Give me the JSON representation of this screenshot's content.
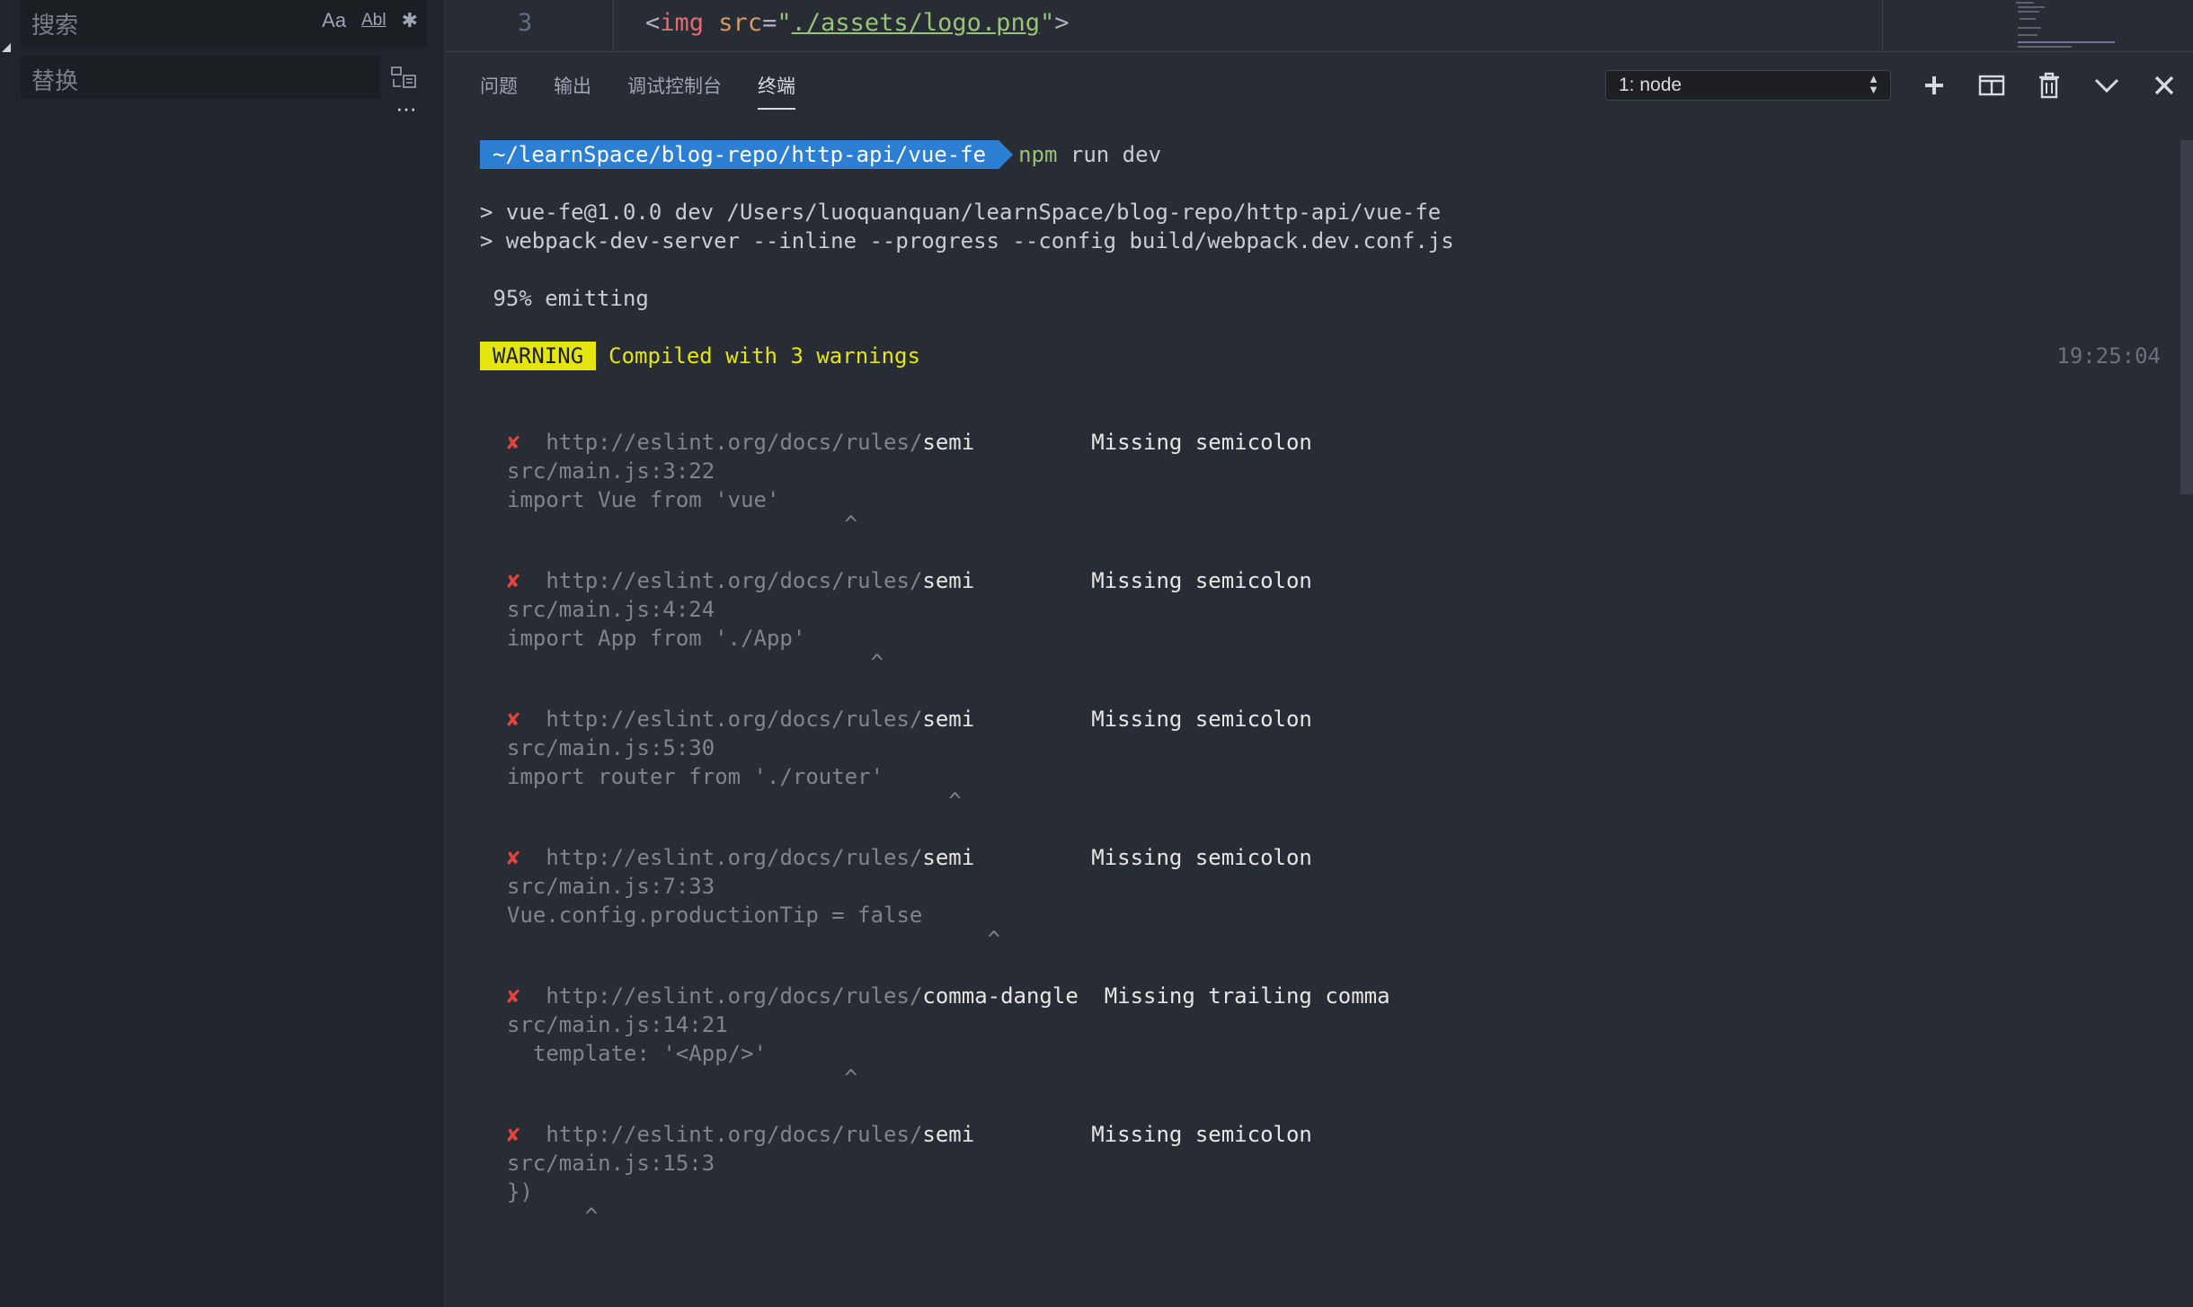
{
  "sidebar": {
    "search_placeholder": "搜索",
    "opt_match_case": "Aa",
    "opt_whole_word": "Abl",
    "opt_regex": "✱",
    "replace_placeholder": "替换",
    "more": "···"
  },
  "editor": {
    "line_number": "3",
    "code": {
      "open": "<",
      "tag": "img",
      "attr": " src",
      "eq": "=",
      "q1": "\"",
      "path": "./assets/logo.png",
      "q2": "\"",
      "close": ">"
    }
  },
  "panel": {
    "tabs": [
      {
        "label": "问题"
      },
      {
        "label": "输出"
      },
      {
        "label": "调试控制台"
      },
      {
        "label": "终端"
      }
    ],
    "active_tab": "终端",
    "terminal_select": "1: node"
  },
  "terminal": {
    "prompt_path": "~/learnSpace/blog-repo/http-api/vue-fe",
    "prompt_cmd_bin": "npm",
    "prompt_cmd_args": " run dev",
    "line_script_1": "> vue-fe@1.0.0 dev /Users/luoquanquan/learnSpace/blog-repo/http-api/vue-fe",
    "line_script_2": "> webpack-dev-server --inline --progress --config build/webpack.dev.conf.js",
    "progress": " 95% emitting",
    "warning_badge": "WARNING",
    "warning_text": "Compiled with 3 warnings",
    "timestamp": "19:25:04",
    "errors": [
      {
        "x": "✘",
        "url": "http://eslint.org/docs/rules/",
        "rule": "semi",
        "pad": "         ",
        "message": "Missing semicolon",
        "loc": "src/main.js:3:22",
        "code": "import Vue from 'vue'",
        "caret": "                          ^"
      },
      {
        "x": "✘",
        "url": "http://eslint.org/docs/rules/",
        "rule": "semi",
        "pad": "         ",
        "message": "Missing semicolon",
        "loc": "src/main.js:4:24",
        "code": "import App from './App'",
        "caret": "                            ^"
      },
      {
        "x": "✘",
        "url": "http://eslint.org/docs/rules/",
        "rule": "semi",
        "pad": "         ",
        "message": "Missing semicolon",
        "loc": "src/main.js:5:30",
        "code": "import router from './router'",
        "caret": "                                  ^"
      },
      {
        "x": "✘",
        "url": "http://eslint.org/docs/rules/",
        "rule": "semi",
        "pad": "         ",
        "message": "Missing semicolon",
        "loc": "src/main.js:7:33",
        "code": "Vue.config.productionTip = false",
        "caret": "                                     ^"
      },
      {
        "x": "✘",
        "url": "http://eslint.org/docs/rules/",
        "rule": "comma-dangle",
        "pad": "  ",
        "message": "Missing trailing comma",
        "loc": "src/main.js:14:21",
        "code": "  template: '<App/>'",
        "caret": "                          ^"
      },
      {
        "x": "✘",
        "url": "http://eslint.org/docs/rules/",
        "rule": "semi",
        "pad": "         ",
        "message": "Missing semicolon",
        "loc": "src/main.js:15:3",
        "code": "})",
        "caret": "      ^"
      }
    ]
  },
  "icons": {
    "add": "plus-icon",
    "split": "split-icon",
    "trash": "trash-icon",
    "collapse": "chevron-down-icon",
    "close": "close-icon"
  }
}
